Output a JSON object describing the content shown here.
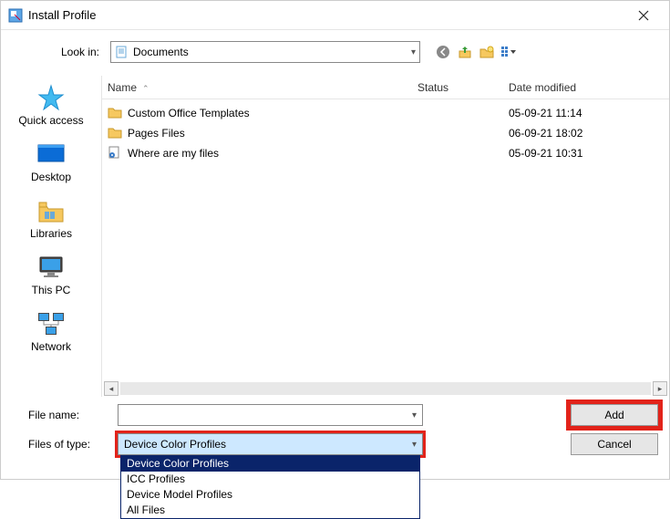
{
  "window": {
    "title": "Install Profile"
  },
  "lookin": {
    "label": "Look in:",
    "value": "Documents"
  },
  "columns": {
    "name": "Name",
    "status": "Status",
    "date": "Date modified"
  },
  "files": [
    {
      "icon": "folder",
      "name": "Custom Office Templates",
      "status": "",
      "date": "05-09-21 11:14"
    },
    {
      "icon": "folder",
      "name": "Pages Files",
      "status": "",
      "date": "06-09-21 18:02"
    },
    {
      "icon": "link",
      "name": "Where are my files",
      "status": "",
      "date": "05-09-21 10:31"
    }
  ],
  "filename": {
    "label": "File name:",
    "value": ""
  },
  "filetype": {
    "label": "Files of type:",
    "value": "Device Color Profiles",
    "options": [
      "Device Color Profiles",
      "ICC Profiles",
      "Device Model Profiles",
      "All Files"
    ]
  },
  "buttons": {
    "add": "Add",
    "cancel": "Cancel"
  },
  "places": {
    "quick": "Quick access",
    "desktop": "Desktop",
    "libraries": "Libraries",
    "thispc": "This PC",
    "network": "Network"
  }
}
